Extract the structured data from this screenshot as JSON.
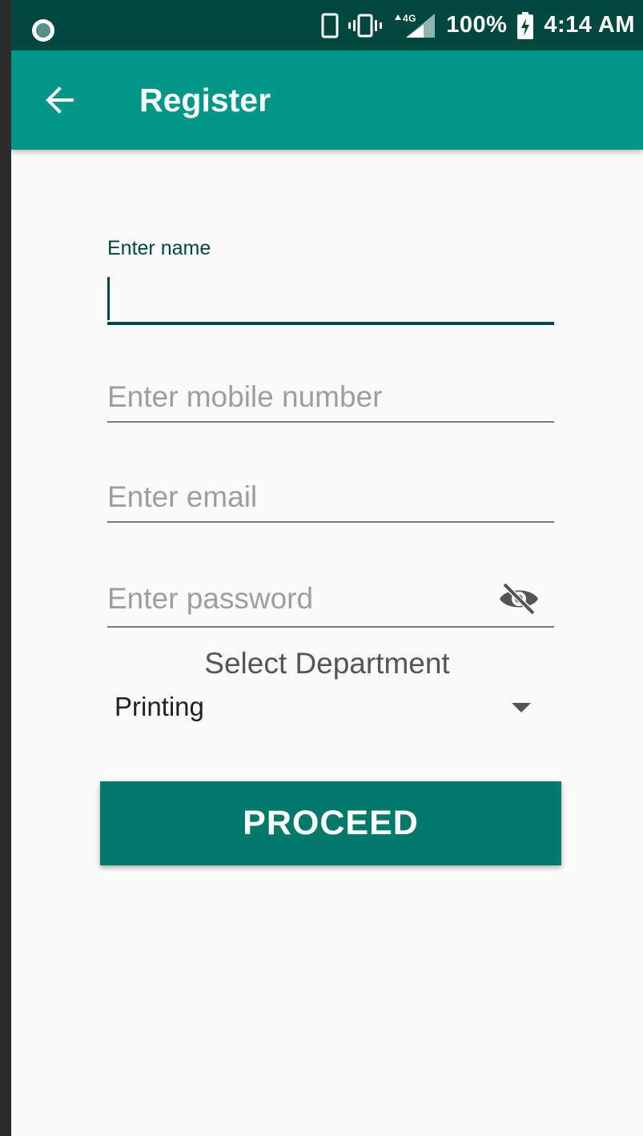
{
  "status_bar": {
    "battery": "100%",
    "time": "4:14 AM",
    "network": "4G"
  },
  "app_bar": {
    "title": "Register"
  },
  "form": {
    "name": {
      "label": "Enter name",
      "value": ""
    },
    "mobile": {
      "placeholder": "Enter mobile number",
      "value": ""
    },
    "email": {
      "placeholder": "Enter email",
      "value": ""
    },
    "password": {
      "placeholder": "Enter password",
      "value": ""
    },
    "department": {
      "label": "Select Department",
      "selected": "Printing"
    },
    "proceed_label": "PROCEED"
  },
  "colors": {
    "status_bar": "#00483f",
    "app_bar": "#009688",
    "button": "#00796b",
    "accent": "#00483f",
    "background": "#fafafa"
  }
}
